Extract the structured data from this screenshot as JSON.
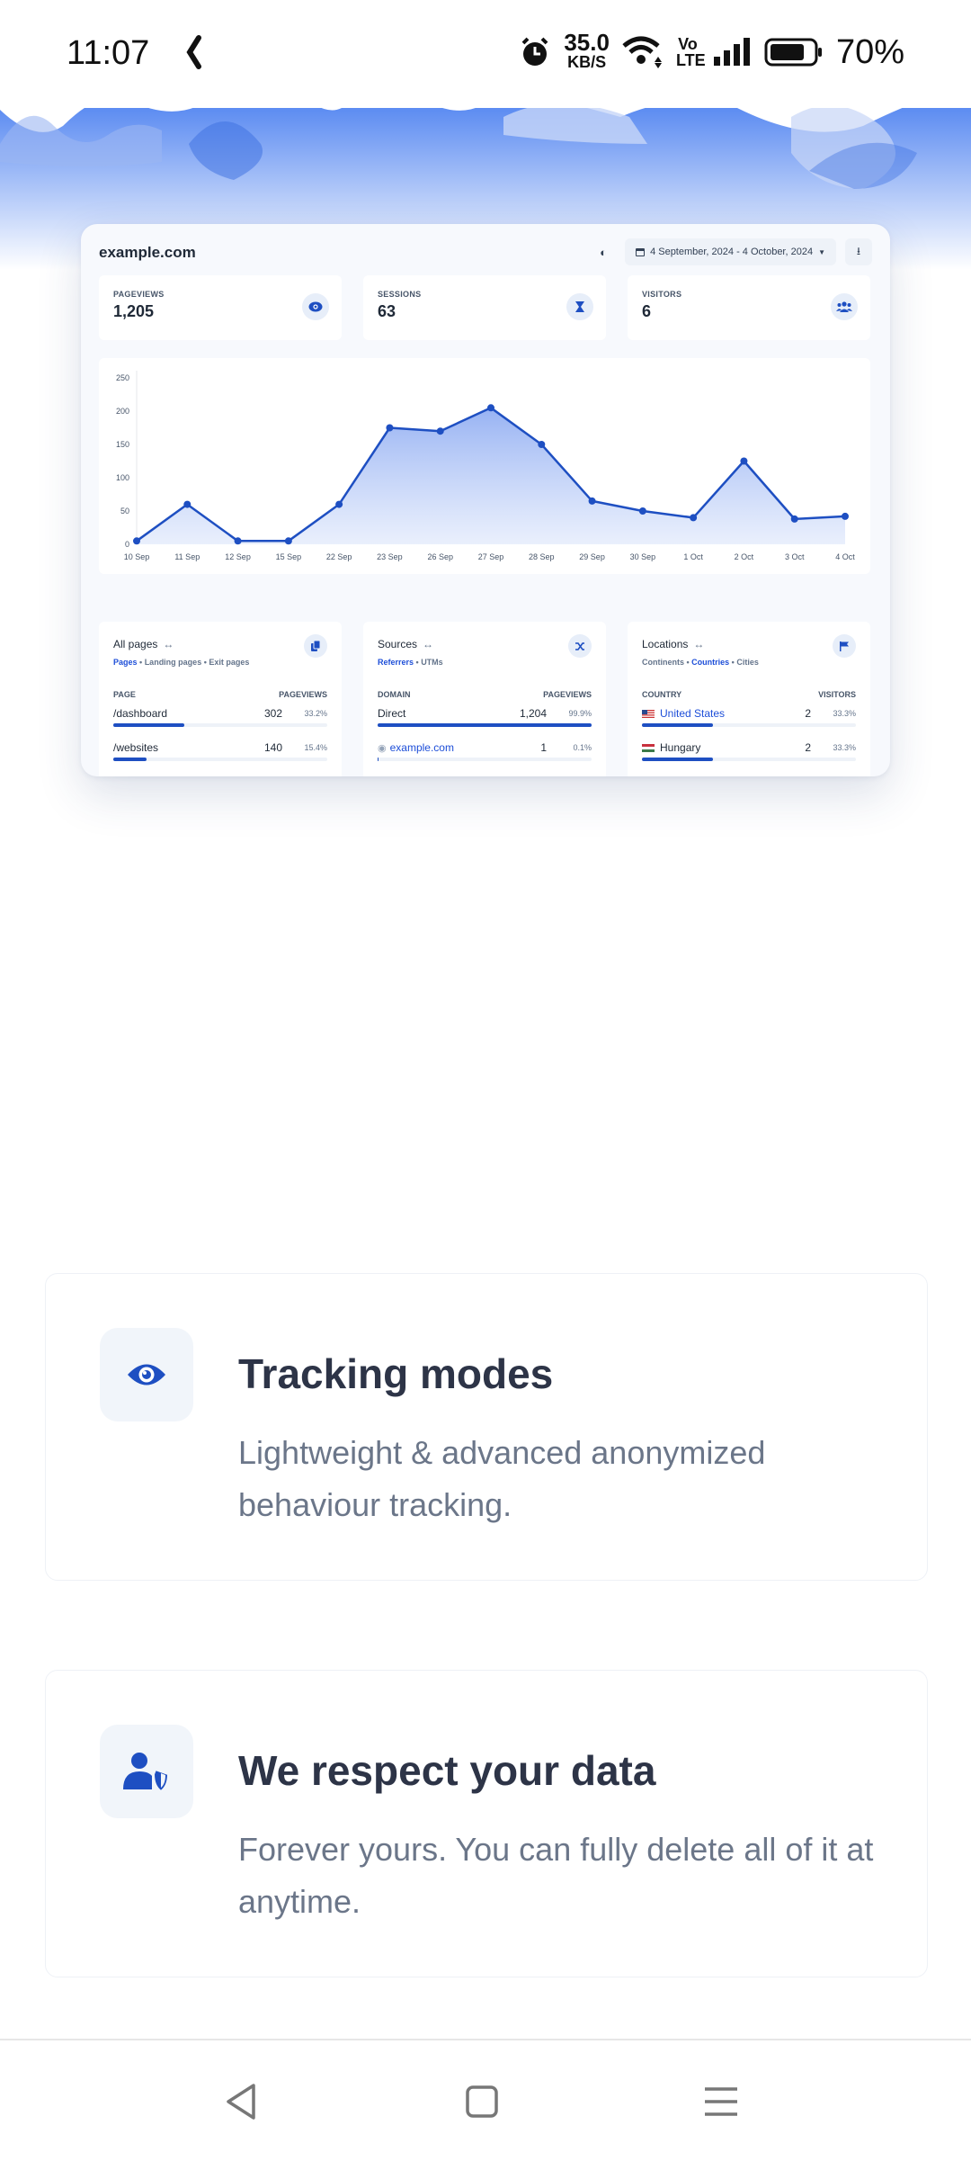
{
  "status_bar": {
    "time": "11:07",
    "speed_value": "35.0",
    "speed_unit": "KB/S",
    "volte": "Vo LTE",
    "battery": "70%"
  },
  "dashboard": {
    "domain": "example.com",
    "date_range": "4 September, 2024 - 4 October, 2024",
    "stats": [
      {
        "label": "PAGEVIEWS",
        "value": "1,205",
        "icon": "eye-icon"
      },
      {
        "label": "SESSIONS",
        "value": "63",
        "icon": "hourglass-icon"
      },
      {
        "label": "VISITORS",
        "value": "6",
        "icon": "users-icon"
      }
    ],
    "panels": {
      "pages": {
        "title": "All pages",
        "tabs": [
          "Pages",
          "Landing pages",
          "Exit pages"
        ],
        "col_left": "PAGE",
        "col_right": "PAGEVIEWS",
        "rows": [
          {
            "name": "/dashboard",
            "value": "302",
            "pct": "33.2%",
            "fill": 0.332
          },
          {
            "name": "/websites",
            "value": "140",
            "pct": "15.4%",
            "fill": 0.154
          }
        ]
      },
      "sources": {
        "title": "Sources",
        "tabs": [
          "Referrers",
          "UTMs"
        ],
        "col_left": "DOMAIN",
        "col_right": "PAGEVIEWS",
        "rows": [
          {
            "name": "Direct",
            "value": "1,204",
            "pct": "99.9%",
            "fill": 0.999
          },
          {
            "name": "example.com",
            "value": "1",
            "pct": "0.1%",
            "fill": 0.001
          }
        ]
      },
      "locations": {
        "title": "Locations",
        "tabs": [
          "Continents",
          "Countries",
          "Cities"
        ],
        "col_left": "COUNTRY",
        "col_right": "VISITORS",
        "rows": [
          {
            "name": "United States",
            "value": "2",
            "pct": "33.3%",
            "fill": 0.333
          },
          {
            "name": "Hungary",
            "value": "2",
            "pct": "33.3%",
            "fill": 0.333
          }
        ]
      }
    }
  },
  "chart_data": {
    "type": "area",
    "x": [
      "10 Sep",
      "11 Sep",
      "12 Sep",
      "15 Sep",
      "22 Sep",
      "23 Sep",
      "26 Sep",
      "27 Sep",
      "28 Sep",
      "29 Sep",
      "30 Sep",
      "1 Oct",
      "2 Oct",
      "3 Oct",
      "4 Oct"
    ],
    "series": [
      {
        "values": [
          5,
          60,
          5,
          5,
          60,
          175,
          170,
          205,
          150,
          65,
          50,
          40,
          125,
          38,
          42
        ]
      }
    ],
    "yticks": [
      0,
      50,
      100,
      150,
      200,
      250
    ],
    "ylim": [
      0,
      250
    ],
    "color": "#1e4fc2",
    "grid": false
  },
  "features": [
    {
      "title": "Tracking modes",
      "desc": "Lightweight & advanced anonymized behaviour tracking.",
      "icon": "eye-icon"
    },
    {
      "title": "We respect your data",
      "desc": "Forever yours. You can fully delete all of it at anytime.",
      "icon": "user-shield-icon"
    }
  ],
  "colors": {
    "accent": "#1e4fc2",
    "hero": "#4a7ff0",
    "title": "#2d3447",
    "muted": "#6b7689"
  }
}
